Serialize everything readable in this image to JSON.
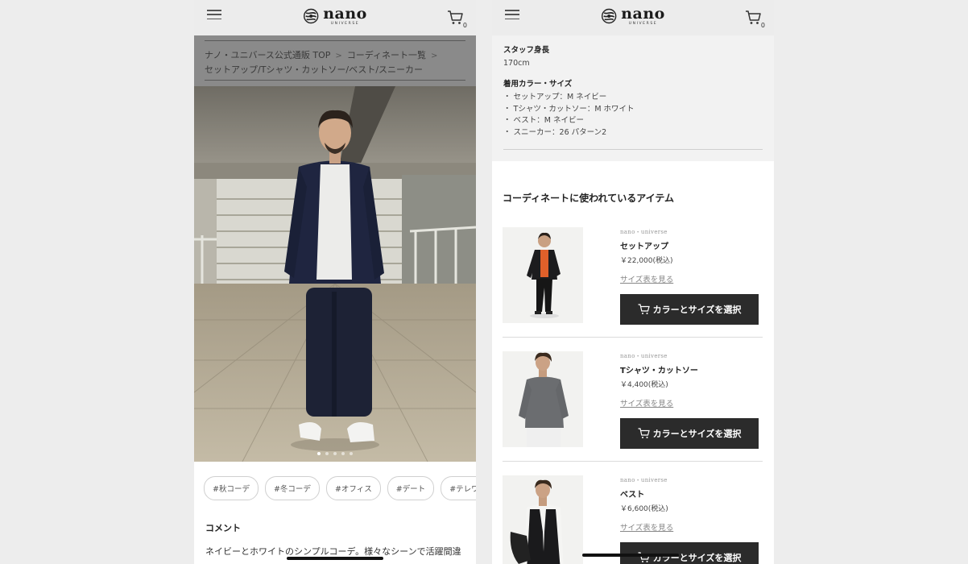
{
  "brand": {
    "name": "nano",
    "sub": "UNIVERSE"
  },
  "left": {
    "cart_count": "0",
    "breadcrumb": [
      "ナノ・ユニバース公式通販 TOP",
      "コーディネート一覧",
      "セットアップ/Tシャツ・カットソー/ベスト/スニーカー"
    ],
    "tags": [
      "#秋コーデ",
      "#冬コーデ",
      "#オフィス",
      "#デート",
      "#テレワーク"
    ],
    "comment_title": "コメント",
    "comment_body": "ネイビーとホワイトのシンプルコーデ。様々なシーンで活躍間違いなし。別売のベストを合わせると上品なイメージに。",
    "carousel": {
      "count": 5,
      "active": 0
    }
  },
  "right": {
    "cart_count": "0",
    "staff_height_label": "スタッフ身長",
    "staff_height_value": "170cm",
    "color_size_label": "着用カラー・サイズ",
    "color_size_items": [
      "セットアップ：M ネイビー",
      "Tシャツ・カットソー：M ホワイト",
      "ベスト：M ネイビー",
      "スニーカー：26 パターン2"
    ],
    "section_title": "コーディネートに使われているアイテム",
    "items": [
      {
        "brand": "nano・universe",
        "name": "セットアップ",
        "price": "￥22,000(税込)",
        "size_link": "サイズ表を見る",
        "button": "カラーとサイズを選択"
      },
      {
        "brand": "nano・universe",
        "name": "Tシャツ・カットソー",
        "price": "￥4,400(税込)",
        "size_link": "サイズ表を見る",
        "button": "カラーとサイズを選択"
      },
      {
        "brand": "nano・universe",
        "name": "ベスト",
        "price": "￥6,600(税込)",
        "size_link": "サイズ表を見る",
        "button": "カラーとサイズを選択"
      }
    ]
  },
  "colors": {
    "header_bg": "#ececec",
    "button_bg": "#2b2b2b",
    "breadcrumb_bg": "#8a8a8a",
    "info_bg": "#f2f2f2"
  },
  "icons": {
    "menu": "hamburger-icon",
    "cart": "cart-icon",
    "logo": "logo-mark-icon"
  }
}
